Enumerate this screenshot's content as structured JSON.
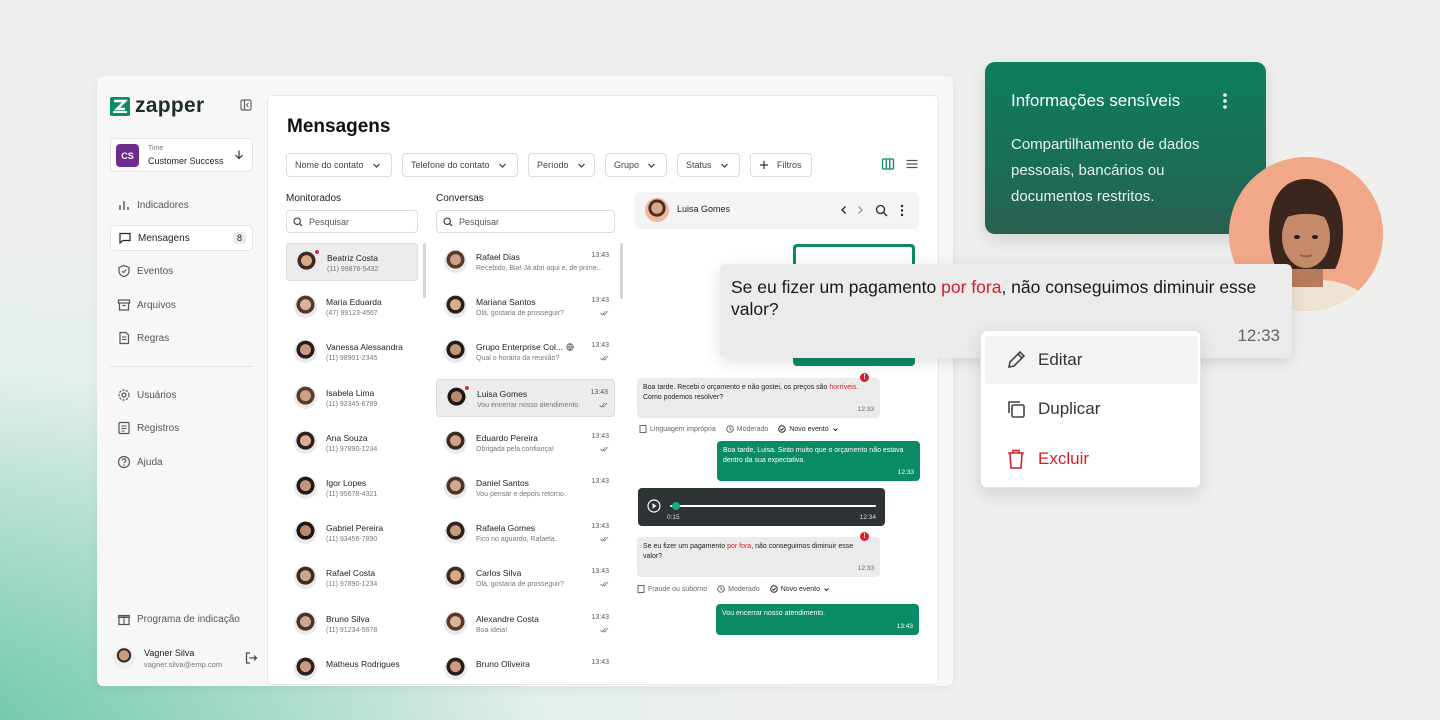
{
  "app": {
    "brand": "zapper"
  },
  "team": {
    "initials": "CS",
    "label": "Time",
    "name": "Customer Success"
  },
  "sidebar": {
    "items": [
      {
        "label": "Indicadores",
        "icon": "bar-chart-icon"
      },
      {
        "label": "Mensagens",
        "icon": "message-icon",
        "badge": "8",
        "active": true
      },
      {
        "label": "Eventos",
        "icon": "shield-icon"
      },
      {
        "label": "Arquivos",
        "icon": "archive-icon"
      },
      {
        "label": "Regras",
        "icon": "document-icon"
      },
      {
        "label": "Usuários",
        "icon": "gear-icon"
      },
      {
        "label": "Registros",
        "icon": "list-icon"
      },
      {
        "label": "Ajuda",
        "icon": "help-icon"
      }
    ],
    "referral": "Programa de indicação"
  },
  "user": {
    "name": "Vagner Silva",
    "email": "vagner.silva@emp.com"
  },
  "main": {
    "title": "Mensagens",
    "filters": [
      "Nome do contato",
      "Telefone do contato",
      "Período",
      "Grupo",
      "Status"
    ],
    "filters_button": "Filtros"
  },
  "monitored": {
    "header": "Monitorados",
    "search_placeholder": "Pesquisar",
    "items": [
      {
        "name": "Beatriz Costa",
        "phone": "(11) 99876-5432",
        "alert": true,
        "selected": true
      },
      {
        "name": "Maria Eduarda",
        "phone": "(47) 99123-4567"
      },
      {
        "name": "Vanessa Alessandra",
        "phone": "(11) 98901-2345"
      },
      {
        "name": "Isabela Lima",
        "phone": "(11) 92345-6789"
      },
      {
        "name": "Ana Souza",
        "phone": "(11) 97890-1234"
      },
      {
        "name": "Igor Lopes",
        "phone": "(11) 95678-4321"
      },
      {
        "name": "Gabriel Pereira",
        "phone": "(11) 93456-7890"
      },
      {
        "name": "Rafael Costa",
        "phone": "(11) 97890-1234"
      },
      {
        "name": "Bruno Silva",
        "phone": "(11) 91234-5678"
      },
      {
        "name": "Matheus Rodrigues",
        "phone": ""
      }
    ]
  },
  "conversations": {
    "header": "Conversas",
    "search_placeholder": "Pesquisar",
    "items": [
      {
        "name": "Rafael Dias",
        "time": "13:43",
        "preview": "Recebido, Bia! Já abri aqui e, de prime..."
      },
      {
        "name": "Mariana Santos",
        "time": "13:43",
        "preview": "Olá, gostaria de prosseguir?"
      },
      {
        "name": "Grupo Enterprise Col...",
        "time": "13:43",
        "preview": "Qual o horário da reunião?"
      },
      {
        "name": "Luisa Gomes",
        "time": "13:43",
        "preview": "Vou encerrar nosso atendimento.",
        "alert": true,
        "selected": true
      },
      {
        "name": "Eduardo Pereira",
        "time": "13:43",
        "preview": "Obrigada pela confiança!"
      },
      {
        "name": "Daniel Santos",
        "time": "13:43",
        "preview": "Vou pensar e depois retorno."
      },
      {
        "name": "Rafaela Gomes",
        "time": "13:43",
        "preview": "Fico no aguardo, Rafaela."
      },
      {
        "name": "Carlos Silva",
        "time": "13:43",
        "preview": "Olá, gostaria de prosseguir?"
      },
      {
        "name": "Alexandre Costa",
        "time": "13:43",
        "preview": "Boa ideia!"
      },
      {
        "name": "Bruno Oliveira",
        "time": "13:43",
        "preview": ""
      }
    ]
  },
  "chat": {
    "contact": "Luisa Gomes",
    "msg1": {
      "pre": "Boa tarde. Recebi o orçamento e não gostei, os preços são ",
      "flag": "horríveis",
      "post": ". Como podemos resolver?",
      "time": "12:33"
    },
    "meta1": {
      "category": "Linguagem imprópria",
      "status": "Moderado",
      "event": "Novo evento"
    },
    "msg2": {
      "text": "Boa tarde, Luisa. Sinto muito que o orçamento não estava dentro da sua expectativa.",
      "time": "12:33"
    },
    "audio": {
      "elapsed": "0:15",
      "time": "12:34",
      "progress": 0.03
    },
    "msg3": {
      "pre": "Se eu fizer um pagamento ",
      "flag": "por fora",
      "post": ", não conseguimos diminuir esse valor?",
      "time": "12:33"
    },
    "meta2": {
      "category": "Fraude ou suborno",
      "status": "Moderado",
      "event": "Novo evento"
    },
    "msg4": {
      "text": "Vou encerrar nosso atendimento.",
      "time": "13:43"
    }
  },
  "info_card": {
    "title": "Informações sensíveis",
    "body": "Compartilhamento de dados pessoais, bancários ou documentos restritos."
  },
  "highlight": {
    "pre": "Se eu fizer um pagamento ",
    "flag": "por fora",
    "post": ", não conseguimos diminuir esse valor?",
    "time": "12:33"
  },
  "context_menu": {
    "edit": "Editar",
    "duplicate": "Duplicar",
    "delete": "Excluir"
  },
  "colors": {
    "brand": "#0b8a66",
    "alert": "#d0202c"
  }
}
